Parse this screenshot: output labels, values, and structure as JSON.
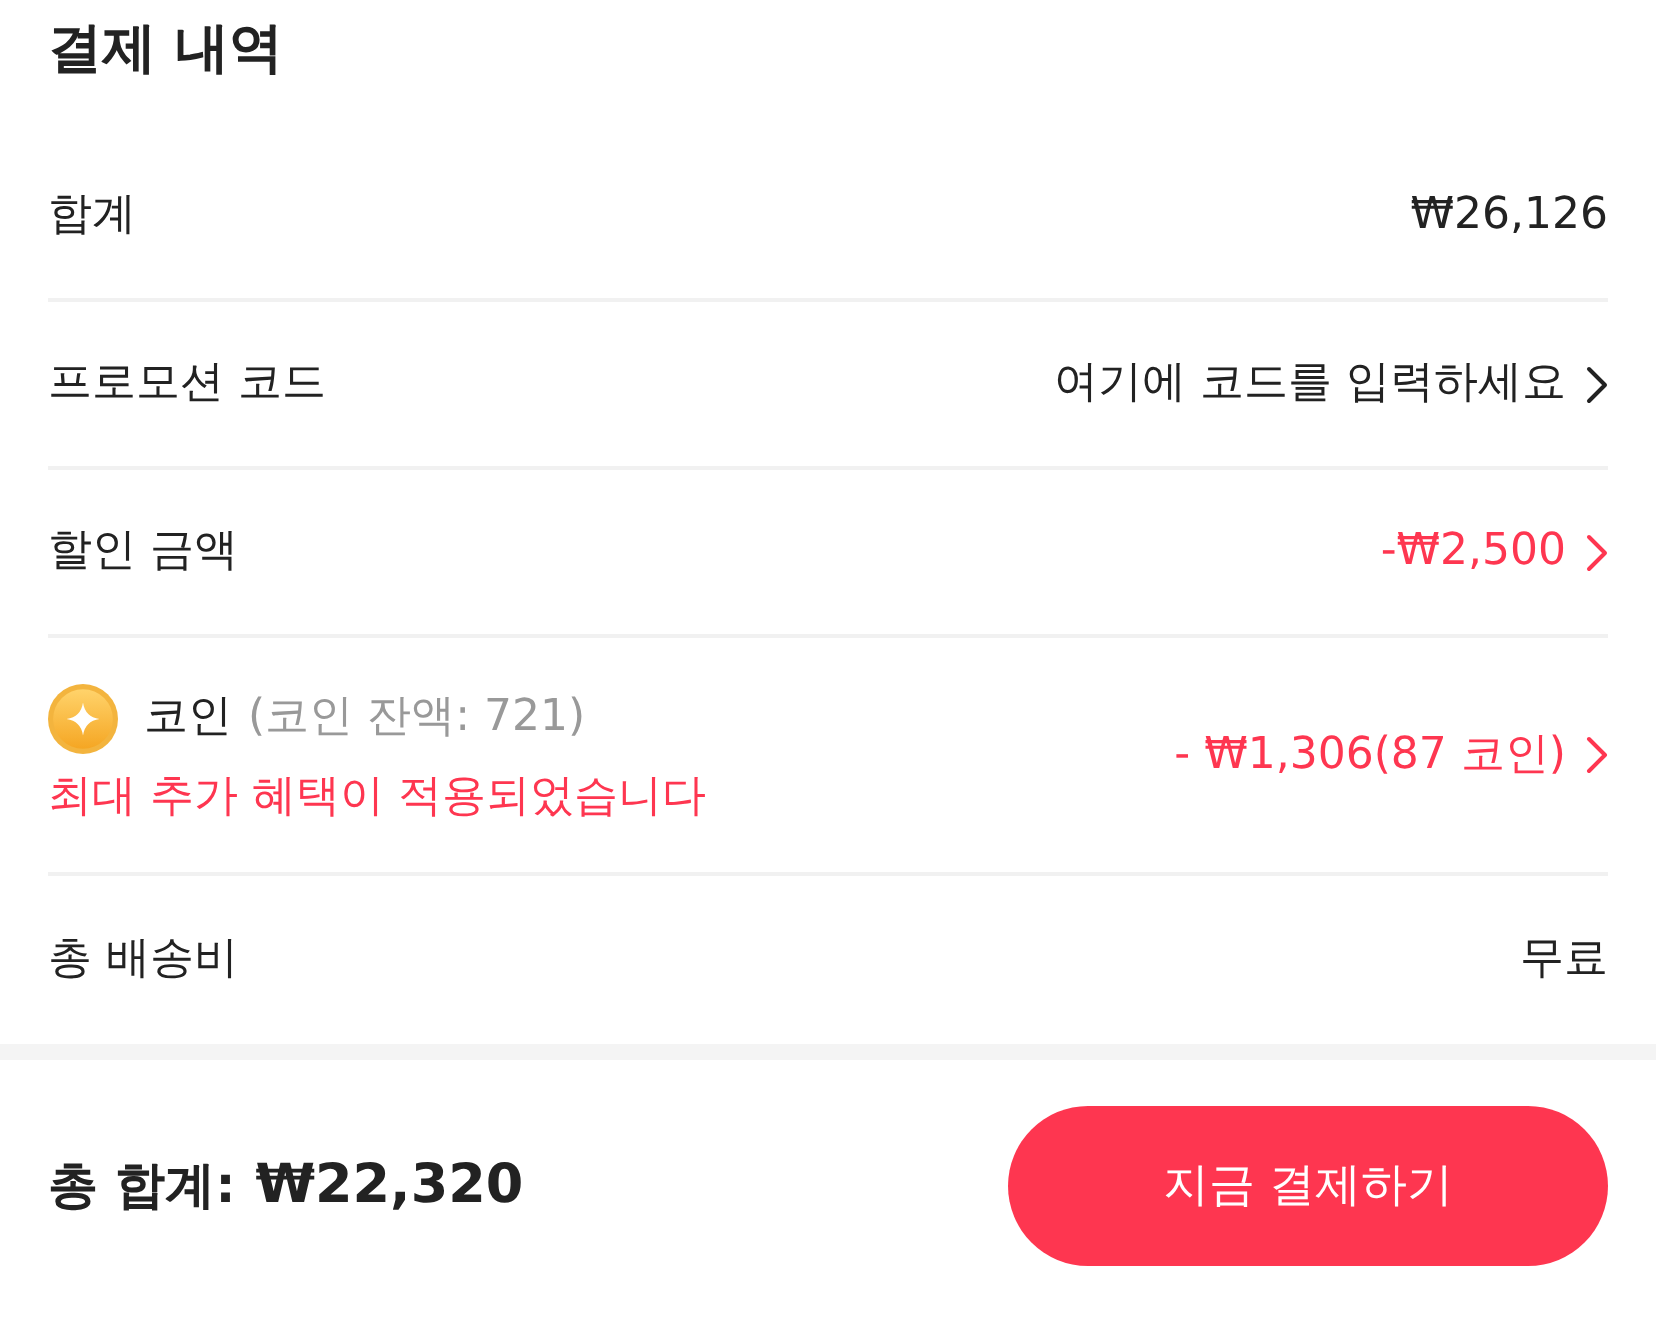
{
  "title": "결제 내역",
  "rows": [
    {
      "kind": "plain",
      "label": "합계",
      "value": "₩26,126",
      "chevron": false
    },
    {
      "kind": "plain",
      "label": "프로모션 코드",
      "value": "여기에 코드를 입력하세요",
      "chevron": true
    },
    {
      "kind": "discount",
      "label": "할인 금액",
      "value": "-₩2,500",
      "chevron": true
    },
    {
      "kind": "coin",
      "label": "코인",
      "balance": "(코인 잔액: 721)",
      "note": "최대 추가 혜택이 적용되었습니다",
      "value": "- ₩1,306(87 코인)",
      "chevron": true
    },
    {
      "kind": "plain",
      "label": "총 배송비",
      "value": "무료",
      "chevron": false
    }
  ],
  "footer": {
    "total_label": "총 합계:",
    "total_value": "₩22,320",
    "pay_button": "지금 결제하기"
  }
}
